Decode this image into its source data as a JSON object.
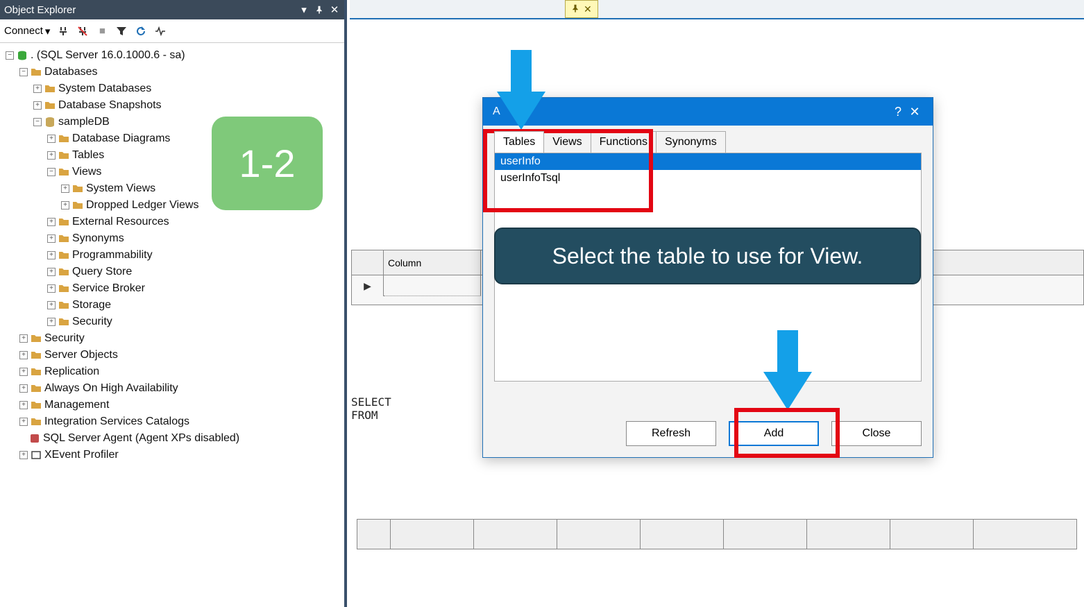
{
  "panel": {
    "title": "Object Explorer",
    "toolbar": {
      "connect": "Connect"
    }
  },
  "tree": {
    "root": ". (SQL Server 16.0.1000.6 - sa)",
    "databases": "Databases",
    "system_databases": "System Databases",
    "database_snapshots": "Database Snapshots",
    "sampledb": "sampleDB",
    "db_diagrams": "Database Diagrams",
    "tables": "Tables",
    "views": "Views",
    "system_views": "System Views",
    "dropped_ledger_views": "Dropped Ledger Views",
    "external_resources": "External Resources",
    "synonyms": "Synonyms",
    "programmability": "Programmability",
    "query_store": "Query Store",
    "service_broker": "Service Broker",
    "storage": "Storage",
    "security_db": "Security",
    "security": "Security",
    "server_objects": "Server Objects",
    "replication": "Replication",
    "always_on": "Always On High Availability",
    "management": "Management",
    "isc": "Integration Services Catalogs",
    "agent": "SQL Server Agent (Agent XPs disabled)",
    "xevent": "XEvent Profiler"
  },
  "badge": {
    "text": "1-2"
  },
  "designer": {
    "column_header": "Column",
    "sql_line1": "SELECT",
    "sql_line2": "FROM"
  },
  "dialog": {
    "title_initial": "A",
    "tabs": {
      "tables": "Tables",
      "views": "Views",
      "functions": "Functions",
      "synonyms": "Synonyms"
    },
    "items": {
      "userInfo": "userInfo",
      "userInfoTsql": "userInfoTsql"
    },
    "buttons": {
      "refresh": "Refresh",
      "add": "Add",
      "close": "Close"
    }
  },
  "callout": {
    "text": "Select the table to use for View."
  }
}
